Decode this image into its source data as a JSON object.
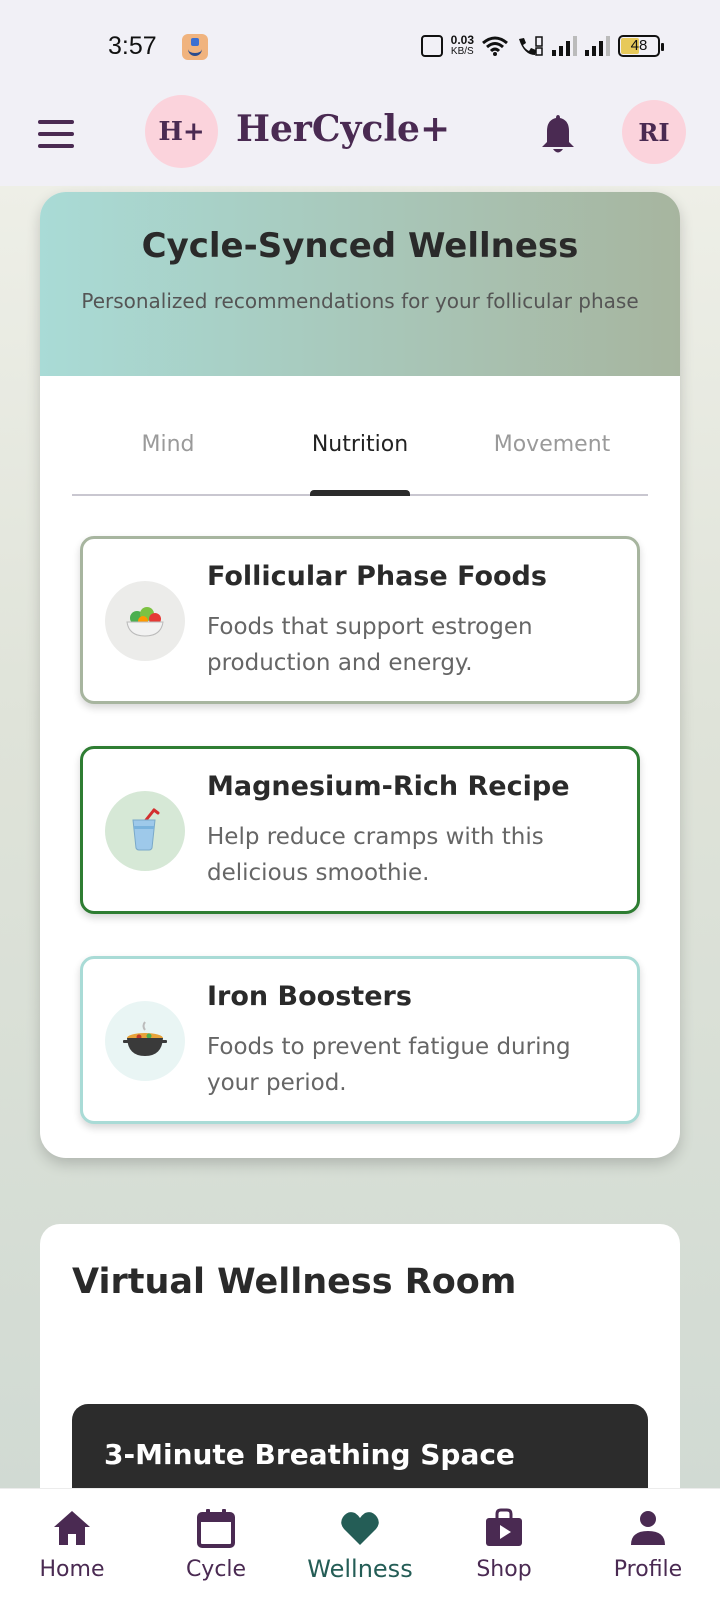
{
  "status_bar": {
    "time": "3:57",
    "net_speed": "0.03",
    "net_unit": "KB/S",
    "battery": "48",
    "battery_level": 0.48,
    "icons": [
      "amazon-app-icon",
      "vibrate-icon",
      "wifi-icon",
      "wifi-call-icon",
      "signal-icon",
      "signal-icon",
      "battery-icon"
    ]
  },
  "app_bar": {
    "logo": "H+",
    "title": "HerCycle+",
    "avatar_initials": "RI",
    "icons": [
      "menu-icon",
      "bell-icon"
    ]
  },
  "wellness": {
    "title": "Cycle-Synced Wellness",
    "subtitle": "Personalized recommendations for your follicular phase",
    "tabs": [
      {
        "label": "Mind",
        "active": false
      },
      {
        "label": "Nutrition",
        "active": true
      },
      {
        "label": "Movement",
        "active": false
      }
    ],
    "recommendations": [
      {
        "icon": "salad-icon",
        "title": "Follicular Phase Foods",
        "description": "Foods that support estrogen production and energy.",
        "accent": "#a7b59f"
      },
      {
        "icon": "smoothie-cup-icon",
        "title": "Magnesium-Rich Recipe",
        "description": "Help reduce cramps with this delicious smoothie.",
        "accent": "#2e7d32"
      },
      {
        "icon": "stew-pot-icon",
        "title": "Iron Boosters",
        "description": "Foods to prevent fatigue during your period.",
        "accent": "#a9dbd6"
      }
    ]
  },
  "wellness_room": {
    "title": "Virtual Wellness Room",
    "session_title": "3-Minute Breathing Space"
  },
  "bottom_nav": [
    {
      "label": "Home",
      "icon": "home-icon",
      "active": false
    },
    {
      "label": "Cycle",
      "icon": "calendar-icon",
      "active": false
    },
    {
      "label": "Wellness",
      "icon": "heart-icon",
      "active": true
    },
    {
      "label": "Shop",
      "icon": "shopping-bag-icon",
      "active": false
    },
    {
      "label": "Profile",
      "icon": "person-icon",
      "active": false
    }
  ],
  "colors": {
    "primary": "#4a2a52",
    "pink_badge": "#fbd3dc",
    "active_nav": "#245d56",
    "header_gradient_start": "#a9dbd6",
    "header_gradient_end": "#a7b59f"
  }
}
